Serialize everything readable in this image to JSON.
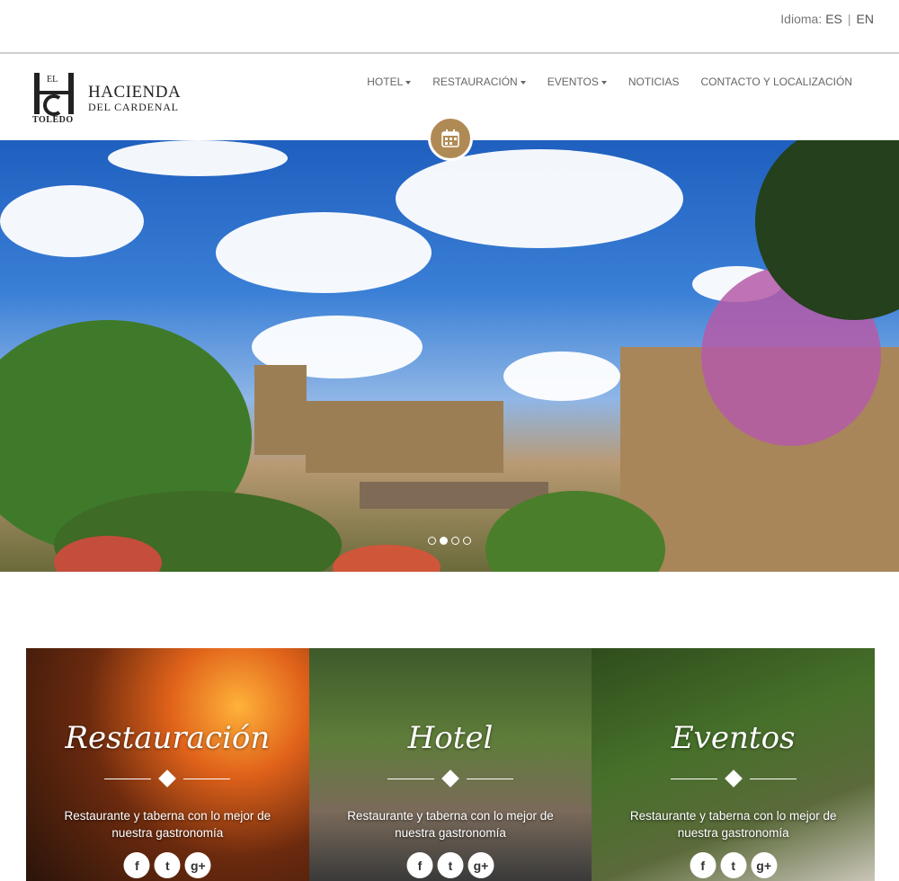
{
  "language": {
    "label": "Idioma:",
    "es": "ES",
    "sep": "|",
    "en": "EN"
  },
  "logo": {
    "monogram": "HDC",
    "small": "EL",
    "city": "TOLEDO",
    "line1": "HACIENDA",
    "line2": "DEL CARDENAL"
  },
  "nav": [
    {
      "label": "HOTEL",
      "dropdown": true
    },
    {
      "label": "RESTAURACIÓN",
      "dropdown": true
    },
    {
      "label": "EVENTOS",
      "dropdown": true
    },
    {
      "label": "NOTICIAS",
      "dropdown": false
    },
    {
      "label": "CONTACTO Y LOCALIZACIÓN",
      "dropdown": false
    }
  ],
  "hero": {
    "slides_total": 4,
    "active_slide": 2
  },
  "colors": {
    "accent": "#b08a55"
  },
  "cards": [
    {
      "title": "Restauración",
      "desc": "Restaurante y taberna con lo mejor de nuestra gastronomía",
      "social": [
        "f",
        "t",
        "g+"
      ]
    },
    {
      "title": "Hotel",
      "desc": "Restaurante y taberna con lo mejor de nuestra gastronomía",
      "social": [
        "f",
        "t",
        "g+"
      ]
    },
    {
      "title": "Eventos",
      "desc": "Restaurante y taberna con lo mejor de nuestra gastronomía",
      "social": [
        "f",
        "t",
        "g+"
      ]
    }
  ]
}
